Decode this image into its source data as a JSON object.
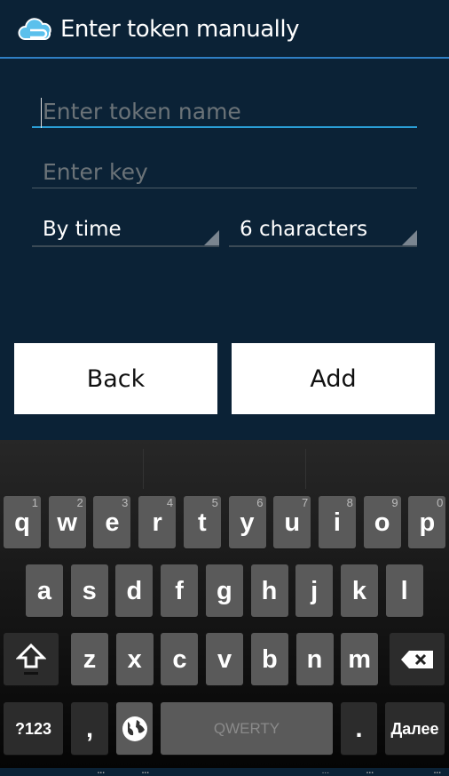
{
  "header": {
    "title": "Enter token manually",
    "icon": "cloud-key-icon",
    "accent": "#2f7fc4"
  },
  "form": {
    "name_placeholder": "Enter token name",
    "key_placeholder": "Enter key",
    "type_select": "By time",
    "length_select": "6 characters"
  },
  "buttons": {
    "back": "Back",
    "add": "Add"
  },
  "keyboard": {
    "row1": [
      [
        "q",
        "1"
      ],
      [
        "w",
        "2"
      ],
      [
        "e",
        "3"
      ],
      [
        "r",
        "4"
      ],
      [
        "t",
        "5"
      ],
      [
        "y",
        "6"
      ],
      [
        "u",
        "7"
      ],
      [
        "i",
        "8"
      ],
      [
        "o",
        "9"
      ],
      [
        "p",
        "0"
      ]
    ],
    "row2": [
      "a",
      "s",
      "d",
      "f",
      "g",
      "h",
      "j",
      "k",
      "l"
    ],
    "row3": [
      "z",
      "x",
      "c",
      "v",
      "b",
      "n",
      "m"
    ],
    "symbols": "?123",
    "comma": ",",
    "space": "QWERTY",
    "period": ".",
    "action": "Далее"
  }
}
